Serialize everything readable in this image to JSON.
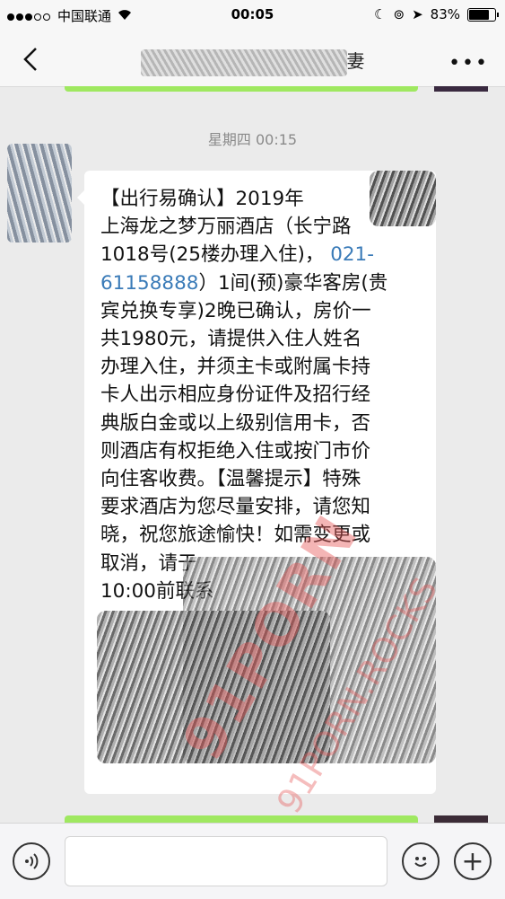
{
  "status_bar": {
    "carrier": "中国联通",
    "time": "00:05",
    "battery": "83%",
    "battery_level": 0.83
  },
  "nav": {
    "title_visible_fragment": "妻"
  },
  "chat": {
    "timestamp": "星期四 00:15",
    "message_lines": [
      "【出行易确认】2019年",
      "上海龙之梦万丽酒店（长宁路",
      "1018号(25楼办理入住)，",
      "021-",
      "61158888",
      "）1间(预)豪华客房(贵",
      "宾兑换专享)2晚已确认，房价一",
      "共1980元，请提供入住人姓名",
      "办理入住，并须主卡或附属卡持",
      "卡人出示相应身份证件及招行经",
      "典版白金或以上级别信用卡，否",
      "则酒店有权拒绝入住或按门市价",
      "向住客收费。【温馨提示】特殊",
      "要求酒店为您尽量安排，请您知",
      "晓，祝您旅途愉快！如需变更或",
      "取消，请于",
      "10:00前联系"
    ]
  },
  "watermark": {
    "text": "91PORN",
    "text2": "91PORN.ROCKS"
  }
}
